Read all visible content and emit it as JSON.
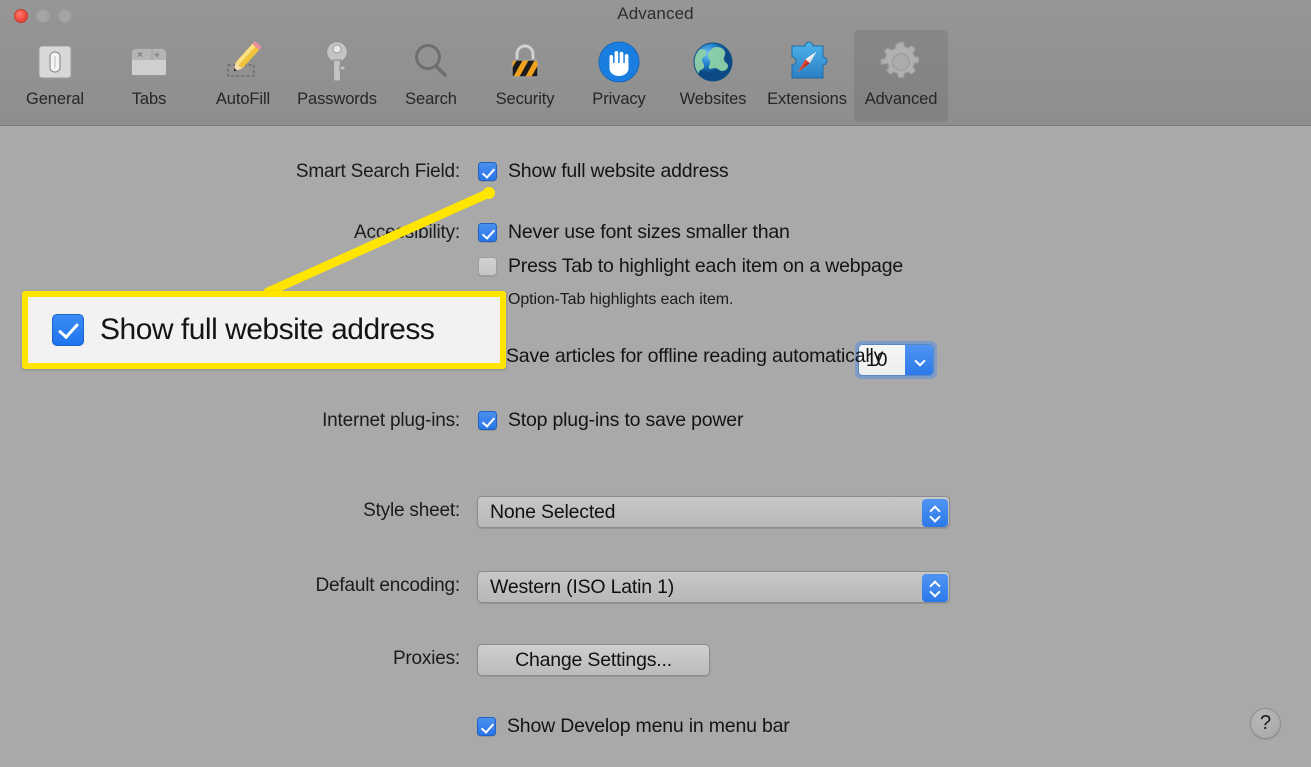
{
  "window": {
    "title": "Advanced",
    "traffic_lights": [
      "close",
      "minimize",
      "zoom"
    ]
  },
  "toolbar": {
    "selected": "Advanced",
    "tabs": [
      {
        "label": "General",
        "icon": "general-switch-icon"
      },
      {
        "label": "Tabs",
        "icon": "tabs-icon"
      },
      {
        "label": "AutoFill",
        "icon": "autofill-pencil-icon"
      },
      {
        "label": "Passwords",
        "icon": "passwords-key-icon"
      },
      {
        "label": "Search",
        "icon": "search-magnifier-icon"
      },
      {
        "label": "Security",
        "icon": "security-padlock-icon"
      },
      {
        "label": "Privacy",
        "icon": "privacy-hand-icon"
      },
      {
        "label": "Websites",
        "icon": "websites-globe-icon"
      },
      {
        "label": "Extensions",
        "icon": "extensions-puzzle-icon"
      },
      {
        "label": "Advanced",
        "icon": "advanced-gear-icon"
      }
    ]
  },
  "settings": {
    "smart_search_field": {
      "label": "Smart Search Field:",
      "show_full_address": {
        "text": "Show full website address",
        "checked": true
      }
    },
    "accessibility": {
      "label": "Accessibility:",
      "never_use_font_sizes": {
        "text": "Never use font sizes smaller than",
        "checked": true
      },
      "font_size_value": "10",
      "press_tab": {
        "text": "Press Tab to highlight each item on a webpage",
        "checked": false
      },
      "option_tab_note": "Option-Tab highlights each item."
    },
    "reading_list": {
      "save_articles": {
        "text": "Save articles for offline reading automatically"
      }
    },
    "internet_plugins": {
      "label": "Internet plug-ins:",
      "stop_plugins": {
        "text": "Stop plug-ins to save power",
        "checked": true
      }
    },
    "style_sheet": {
      "label": "Style sheet:",
      "value": "None Selected"
    },
    "default_encoding": {
      "label": "Default encoding:",
      "value": "Western (ISO Latin 1)"
    },
    "proxies": {
      "label": "Proxies:",
      "button": "Change Settings..."
    },
    "develop_menu": {
      "text": "Show Develop menu in menu bar",
      "checked": true
    }
  },
  "callout": {
    "text": "Show full website address",
    "checked": true,
    "border_color": "#ffe500",
    "background": "#f2f2f2"
  },
  "help": {
    "label": "?"
  },
  "colors": {
    "panel_background": "#a9a9a9",
    "toolbar_background": "#919191",
    "checkbox_blue": "#2c79ea",
    "highlight_yellow": "#ffe500"
  }
}
